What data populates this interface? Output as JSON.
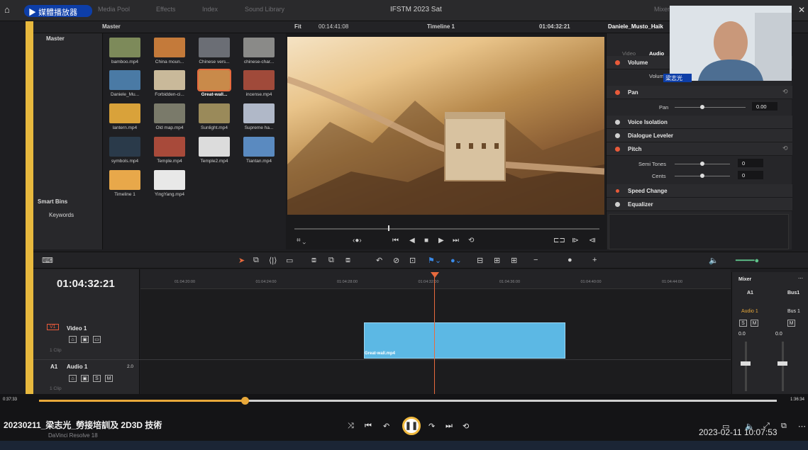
{
  "titlebar": {
    "player_name": "媒體播放器",
    "tab_media_pool": "Media Pool",
    "tab_effects": "Effects",
    "tab_index": "Index",
    "tab_sound_library": "Sound Library",
    "project_title": "IFSTM 2023 Sat",
    "tab_mixer": "Mixer",
    "minimize": "–",
    "close": "✕"
  },
  "toolbar": {
    "bin_name": "Master",
    "fit": "Fit",
    "source_timecode": "00:14:41:08",
    "timeline_name": "Timeline 1",
    "timeline_timecode": "01:04:32:21",
    "clip_name": "Daniele_Musto_Haik"
  },
  "bins": {
    "master": "Master",
    "smart_bins": "Smart Bins",
    "keywords": "Keywords"
  },
  "clips": [
    {
      "name": "bamboo.mp4",
      "color": "#7d8a5a"
    },
    {
      "name": "China moun...",
      "color": "#c47a3a"
    },
    {
      "name": "Chinese vers...",
      "color": "#6b6e75"
    },
    {
      "name": "chinese-char...",
      "color": "#8a8a88"
    },
    {
      "name": "Daniele_Mu...",
      "color": "#4a7aa5"
    },
    {
      "name": "Forbidden-ci...",
      "color": "#c9b99a"
    },
    {
      "name": "Great-wall...",
      "color": "#c98a4a"
    },
    {
      "name": "incense.mp4",
      "color": "#a04a3a"
    },
    {
      "name": "lantern.mp4",
      "color": "#d9a23a"
    },
    {
      "name": "Old map.mp4",
      "color": "#7a7a6a"
    },
    {
      "name": "Sunlight.mp4",
      "color": "#9a8a5a"
    },
    {
      "name": "Supreme ha...",
      "color": "#b0b8c8"
    },
    {
      "name": "symbols.mp4",
      "color": "#2a3a4a"
    },
    {
      "name": "Temple.mp4",
      "color": "#a84a3a"
    },
    {
      "name": "Temple2.mp4",
      "color": "#dcdcdc"
    },
    {
      "name": "Tiantan.mp4",
      "color": "#5a8ac0"
    },
    {
      "name": "Timeline 1",
      "color": "#e8a84a"
    },
    {
      "name": "YingYang.mp4",
      "color": "#e8e8e8"
    }
  ],
  "inspector": {
    "tab_video": "Video",
    "tab_audio": "Audio",
    "volume": "Volume",
    "volume_sub": "Volume",
    "pan": "Pan",
    "pan_sub": "Pan",
    "pan_value": "0.00",
    "voice_isolation": "Voice Isolation",
    "dialogue_leveler": "Dialogue Leveler",
    "pitch": "Pitch",
    "semi_tones": "Semi Tones",
    "semi_tones_value": "0",
    "cents": "Cents",
    "cents_value": "0",
    "speed_change": "Speed Change",
    "equalizer": "Equalizer"
  },
  "webcam": {
    "name_label": "梁志光"
  },
  "timeline": {
    "timecode": "01:04:32:21",
    "ruler": [
      "01:04:20:00",
      "01:04:24:00",
      "01:04:28:00",
      "01:04:32:00",
      "01:04:36:00",
      "01:04:40:00",
      "01:04:44:00"
    ],
    "video_track_badge": "V1",
    "video_track_name": "Video 1",
    "video_track_clips": "1 Clip",
    "audio_track_badge": "A1",
    "audio_track_name": "Audio 1",
    "audio_track_level": "2.0",
    "audio_track_clips": "1 Clip",
    "clip_label": "Great-wall.mp4"
  },
  "mixer": {
    "title": "Mixer",
    "ch1": "A1",
    "ch2": "Bus1",
    "ch1_route": "Audio 1",
    "ch2_route": "Bus 1",
    "db1": "0.0",
    "db2": "0.0",
    "solo": "S",
    "mute": "M"
  },
  "player": {
    "current": "0:37:33",
    "total": "1:36:34",
    "progress_fraction": 0.2,
    "video_title": "20230211_梁志光_勞接培訓及 2D3D 技術",
    "app_name": "DaVinci Resolve 18",
    "datetime": "2023-02-11  10:07:53"
  }
}
